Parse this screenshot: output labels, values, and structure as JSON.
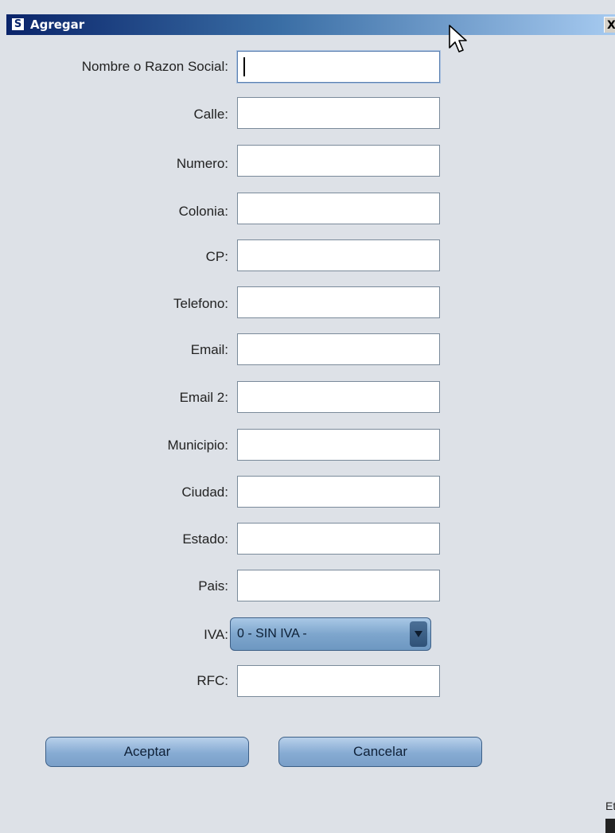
{
  "window": {
    "title": "Agregar",
    "icon_glyph": "S",
    "close_glyph": "X"
  },
  "form": {
    "fields": [
      {
        "id": "nombre",
        "label": "Nombre o Razon Social:",
        "value": ""
      },
      {
        "id": "calle",
        "label": "Calle:",
        "value": ""
      },
      {
        "id": "numero",
        "label": "Numero:",
        "value": ""
      },
      {
        "id": "colonia",
        "label": "Colonia:",
        "value": ""
      },
      {
        "id": "cp",
        "label": "CP:",
        "value": ""
      },
      {
        "id": "telefono",
        "label": "Telefono:",
        "value": ""
      },
      {
        "id": "email",
        "label": "Email:",
        "value": ""
      },
      {
        "id": "email2",
        "label": "Email 2:",
        "value": ""
      },
      {
        "id": "municipio",
        "label": "Municipio:",
        "value": ""
      },
      {
        "id": "ciudad",
        "label": "Ciudad:",
        "value": ""
      },
      {
        "id": "estado",
        "label": "Estado:",
        "value": ""
      },
      {
        "id": "pais",
        "label": "Pais:",
        "value": ""
      }
    ],
    "iva": {
      "label": "IVA:",
      "selected": "0 - SIN IVA -"
    },
    "rfc": {
      "label": "RFC:",
      "value": ""
    }
  },
  "buttons": {
    "accept_label": "Aceptar",
    "cancel_label": "Cancelar"
  },
  "background": {
    "fragment_text": "Et"
  },
  "colors": {
    "titlebar_start": "#0a246a",
    "button_fill": "#86abd3",
    "window_bg": "#dde1e7"
  },
  "icons": [
    "app-s-icon",
    "close-icon",
    "mouse-cursor-icon",
    "dropdown-arrow-icon"
  ]
}
